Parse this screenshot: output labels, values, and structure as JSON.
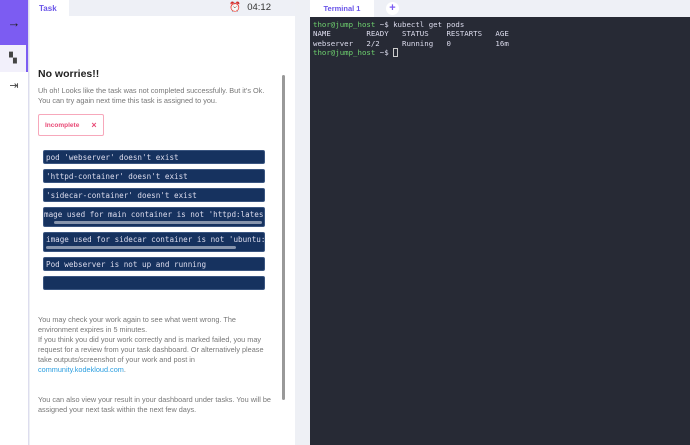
{
  "sidebar": {
    "icons": [
      "arrow-right-icon",
      "dashboard-icon",
      "logout-icon"
    ]
  },
  "task": {
    "tab": "Task",
    "timer": "04:12",
    "title": "No worries!!",
    "intro": "Uh oh! Looks like the task was not completed successfully. But it's Ok. You can try again next time this task is assigned to you.",
    "badge": "Incomplete",
    "badge_x": "×",
    "checks": [
      "pod 'webserver' doesn't exist",
      "'httpd-container' doesn't exist",
      "'sidecar-container' doesn't exist",
      "mage used for main container is not 'httpd:latest'",
      "image used for sidecar container is not 'ubuntu:latest'",
      "Pod webserver is not up and running",
      ""
    ],
    "p1": "You may check your work again to see what went wrong. The environment expires in 5 minutes.",
    "p2": "If you think you did your work correctly and is marked failed, you may request for a review from your task dashboard. Or alternatively please take outputs/screenshot of your work and post in ",
    "link": "community.kodekloud.com",
    "p2_end": ".",
    "p3": "You can also view your result in your dashboard under tasks. You will be assigned your next task within the next few days."
  },
  "terminal": {
    "tab": "Terminal 1",
    "plus": "+",
    "prompt": "thor@jump_host",
    "prompt_sym": " ~$ ",
    "cmd": "kubectl get pods",
    "header": "NAME        READY   STATUS    RESTARTS   AGE",
    "row": "webserver   2/2     Running   0          16m"
  }
}
